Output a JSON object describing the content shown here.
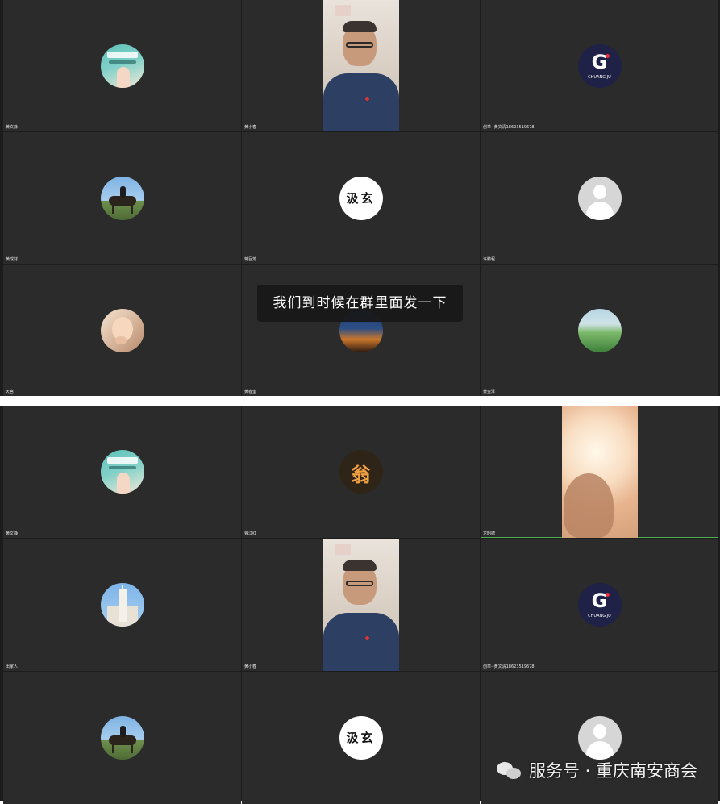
{
  "top": {
    "tiles": [
      {
        "name": "黄文静",
        "kind": "avatar",
        "avatar": "poster-avatar"
      },
      {
        "name": "黄小春",
        "kind": "video",
        "video": "man-with-glasses"
      },
      {
        "name": "创举--黄文清18623519678",
        "kind": "avatar",
        "avatar": "chuangju-logo"
      },
      {
        "name": "黄成财",
        "kind": "avatar",
        "avatar": "horse-rider"
      },
      {
        "name": "蒋巨芳",
        "kind": "avatar",
        "avatar": "text-logo"
      },
      {
        "name": "许鹏程",
        "kind": "avatar",
        "avatar": "default-user"
      },
      {
        "name": "天宫",
        "kind": "avatar",
        "avatar": "baby-photo"
      },
      {
        "name": "黄春奎",
        "kind": "avatar",
        "avatar": "city-night"
      },
      {
        "name": "黄金泽",
        "kind": "avatar",
        "avatar": "green-hills"
      }
    ],
    "subtitle": "我们到时候在群里面发一下"
  },
  "bottom": {
    "tiles": [
      {
        "name": "黄文静",
        "kind": "avatar",
        "avatar": "poster-avatar"
      },
      {
        "name": "曹江红",
        "kind": "avatar",
        "avatar": "weng-character"
      },
      {
        "name": "龙昭德",
        "kind": "video",
        "video": "bright-window",
        "active": true
      },
      {
        "name": "出家人",
        "kind": "avatar",
        "avatar": "church"
      },
      {
        "name": "黄小春",
        "kind": "video",
        "video": "man-with-glasses"
      },
      {
        "name": "创举--黄文清18623519678",
        "kind": "avatar",
        "avatar": "chuangju-logo"
      },
      {
        "name": "",
        "kind": "avatar",
        "avatar": "horse-rider"
      },
      {
        "name": "",
        "kind": "avatar",
        "avatar": "text-logo"
      },
      {
        "name": "",
        "kind": "avatar",
        "avatar": "default-user"
      }
    ]
  },
  "avatar_text": {
    "chuangju_letter": "G",
    "chuangju_sub": "CHUANG JU",
    "text_logo": "汲玄",
    "weng": "翁"
  },
  "watermark": {
    "icon": "wechat-icon",
    "text": "服务号 · 重庆南安商会"
  },
  "colors": {
    "tile_bg": "#2b2b2b",
    "panel_bg": "#1c1c1c",
    "active_border": "#4caf50"
  }
}
